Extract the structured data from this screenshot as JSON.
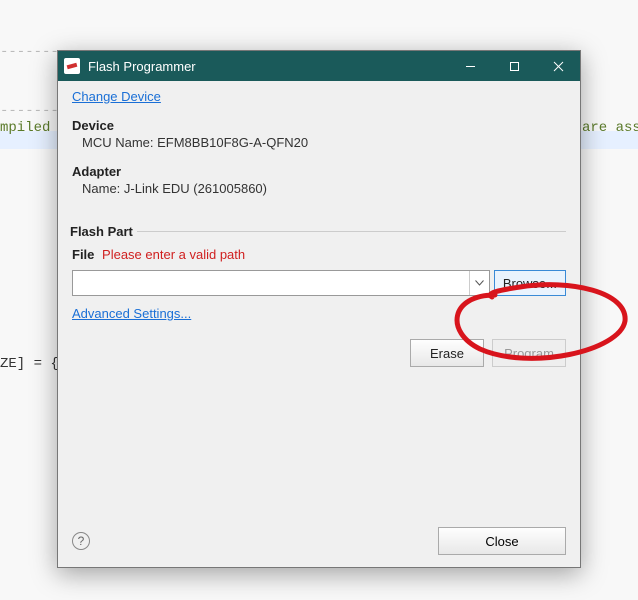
{
  "background": {
    "mpiled_fragment": "mpiled",
    "are_ass_fragment": "are ass",
    "ze_fragment": "ZE] = {"
  },
  "window": {
    "title": "Flash Programmer",
    "change_device_link": "Change Device",
    "device_heading": "Device",
    "device_mcu_line": "MCU Name: EFM8BB10F8G-A-QFN20",
    "adapter_heading": "Adapter",
    "adapter_name_line": "Name: J-Link EDU (261005860)",
    "flash_part_legend": "Flash Part",
    "file_label": "File",
    "file_error": "Please enter a valid path",
    "path_value": "",
    "browse_label": "Browse...",
    "advanced_settings_link": "Advanced Settings...",
    "erase_label": "Erase",
    "program_label": "Program",
    "help_glyph": "?",
    "close_label": "Close"
  }
}
